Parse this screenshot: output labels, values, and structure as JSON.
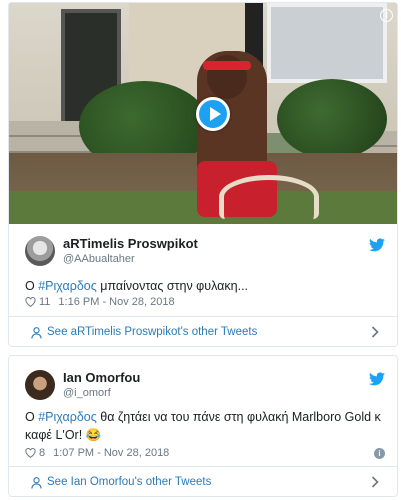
{
  "tweets": [
    {
      "display_name": "aRTimelis Proswpikot",
      "handle": "@AAbualtaher",
      "text_before": "Ο ",
      "hashtag": "#Ριχαρδος",
      "text_after": " μπαίνοντας στην φυλακη...",
      "likes": "11",
      "timestamp": "1:16 PM - Nov 28, 2018",
      "other_tweets_label": "See aRTimelis Proswpikot's other Tweets",
      "has_video": true
    },
    {
      "display_name": "Ian Omorfou",
      "handle": "@i_omorf",
      "text_before": "Ο ",
      "hashtag": "#Ριχαρδος",
      "text_after": " θα ζητάει να του πάνε στη φυλακή Marlboro Gold κ καφέ L'Or! 😂",
      "likes": "8",
      "timestamp": "1:07 PM - Nov 28, 2018",
      "other_tweets_label": "See Ian Omorfou's other Tweets"
    }
  ],
  "icons": {
    "info": "i",
    "brand_color": "#1da1f2",
    "link_color": "#2b7bb9"
  }
}
